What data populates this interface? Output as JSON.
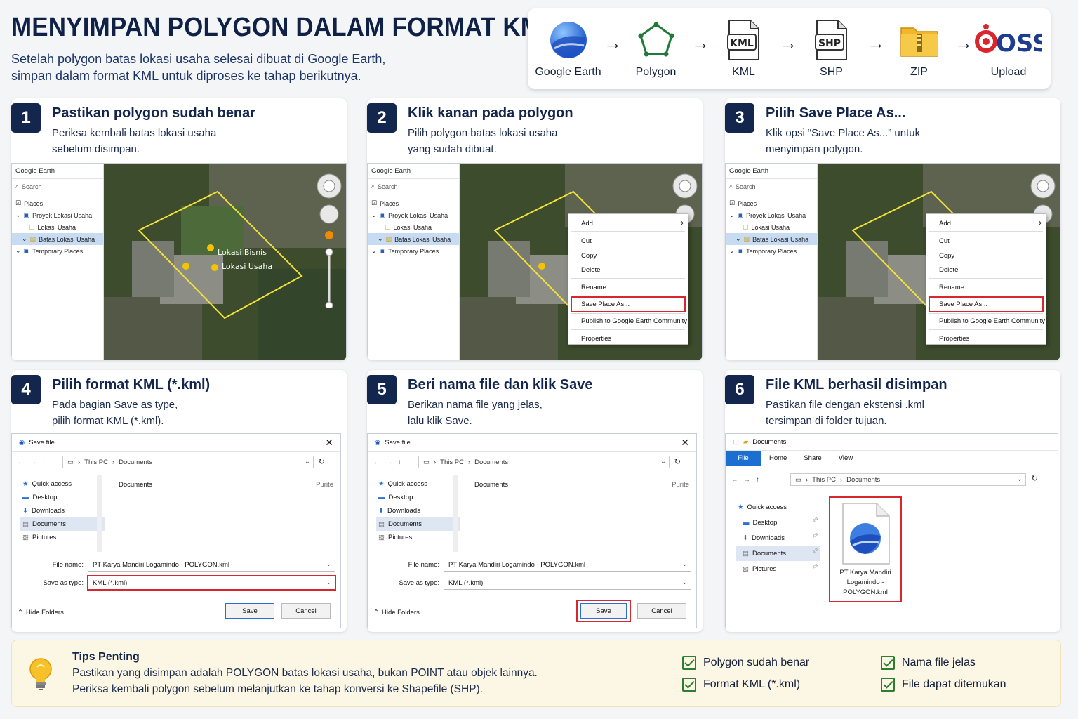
{
  "header": {
    "title": "MENYIMPAN POLYGON DALAM FORMAT KML",
    "subtitle_line1": "Setelah polygon batas lokasi usaha selesai dibuat di Google Earth,",
    "subtitle_line2": "simpan dalam format KML untuk diproses ke tahap berikutnya."
  },
  "flow": {
    "items": [
      {
        "label": "Google Earth",
        "icon": "google-earth-icon"
      },
      {
        "label": "Polygon",
        "icon": "polygon-icon"
      },
      {
        "label": "KML",
        "icon": "kml-file-icon",
        "badge": "KML"
      },
      {
        "label": "SHP",
        "icon": "shp-file-icon",
        "badge": "SHP"
      },
      {
        "label": "ZIP",
        "icon": "zip-folder-icon"
      },
      {
        "label": "Upload",
        "icon": "oss-logo",
        "logo": "OSS"
      }
    ],
    "arrow": "→"
  },
  "steps": [
    {
      "num": "1",
      "title": "Pastikan polygon sudah benar",
      "desc1": "Periksa kembali batas lokasi usaha",
      "desc2": "sebelum disimpan."
    },
    {
      "num": "2",
      "title": "Klik kanan pada polygon",
      "desc1": "Pilih polygon batas lokasi usaha",
      "desc2": "yang sudah dibuat."
    },
    {
      "num": "3",
      "title": "Pilih Save Place As...",
      "desc1": "Klik opsi “Save Place As...” untuk",
      "desc2": "menyimpan polygon."
    },
    {
      "num": "4",
      "title": "Pilih format KML (*.kml)",
      "desc1": "Pada bagian Save as type,",
      "desc2": "pilih format KML (*.kml)."
    },
    {
      "num": "5",
      "title": "Beri nama file dan klik Save",
      "desc1": "Berikan nama file yang jelas,",
      "desc2": "lalu klik Save."
    },
    {
      "num": "6",
      "title": "File KML berhasil disimpan",
      "desc1": "Pastikan file dengan ekstensi .kml",
      "desc2": "tersimpan di folder tujuan."
    }
  ],
  "ge": {
    "app_title": "Google Earth",
    "search": "Search",
    "places": "Places",
    "project": "Proyek Lokasi Usaha",
    "lokasi": "Lokasi Usaha",
    "batas": "Batas Lokasi Usaha",
    "temporary": "Temporary Places",
    "map_label1": "Lokasi Bisnis",
    "map_label2": "Lokasi Usaha"
  },
  "context_menu": {
    "add": "Add",
    "cut": "Cut",
    "copy": "Copy",
    "delete": "Delete",
    "rename": "Rename",
    "save_place_as": "Save Place As...",
    "publish": "Publish to Google Earth Community",
    "properties": "Properties",
    "submenu_arrow": "›"
  },
  "save_dialog": {
    "title": "Save file...",
    "path_pc": "This PC",
    "path_docs": "Documents",
    "folder_heading": "Documents",
    "column": "Purite",
    "quick_access": "Quick access",
    "desktop": "Desktop",
    "downloads": "Downloads",
    "documents": "Documents",
    "pictures": "Pictures",
    "file_name_label": "File name:",
    "file_name": "PT Karya Mandiri Logamindo - POLYGON.kml",
    "save_type_label": "Save as type:",
    "save_type": "KML (*.kml)",
    "save": "Save",
    "cancel": "Cancel",
    "hide_folders": "Hide Folders"
  },
  "explorer": {
    "title": "Documents",
    "tabs": [
      "File",
      "Home",
      "Share",
      "View"
    ],
    "path_pc": "This PC",
    "path_docs": "Documents",
    "quick_access": "Quick access",
    "desktop": "Desktop",
    "downloads": "Downloads",
    "documents": "Documents",
    "pictures": "Pictures",
    "file_line1": "PT Karya Mandiri",
    "file_line2": "Logamindo -",
    "file_line3": "POLYGON.kml"
  },
  "tips": {
    "title": "Tips Penting",
    "line1": "Pastikan yang disimpan adalah POLYGON batas lokasi usaha, bukan POINT atau objek lainnya.",
    "line2": "Periksa kembali polygon sebelum melanjutkan ke tahap konversi ke Shapefile (SHP).",
    "checks": [
      "Polygon sudah benar",
      "Nama file jelas",
      "Format KML (*.kml)",
      "File dapat ditemukan"
    ]
  },
  "colors": {
    "navy": "#13264d",
    "highlight_red": "#d9262c",
    "check_green": "#2e7d32",
    "tips_bg": "#fcf6e4"
  }
}
